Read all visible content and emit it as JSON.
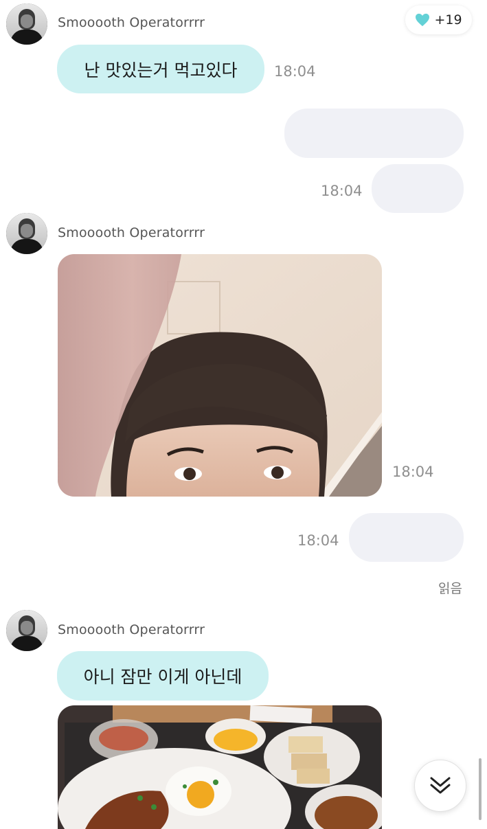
{
  "reaction": {
    "icon": "heart-icon",
    "count": "+19",
    "heart_color": "#63d1d6"
  },
  "messages": [
    {
      "sender": "Smooooth Operatorrrr",
      "text": "난 맛있는거 먹고있다",
      "time": "18:04"
    },
    {
      "outgoing_time": "18:04"
    },
    {
      "sender": "Smooooth Operatorrrr",
      "photo": "selfie-photo",
      "time": "18:04"
    },
    {
      "outgoing_time": "18:04",
      "status": "읽음"
    },
    {
      "sender": "Smooooth Operatorrrr",
      "text": "아니 잠만 이게 아닌데",
      "photo": "food-photo"
    }
  ],
  "scroll_button": {
    "icon": "double-chevron-down-icon"
  },
  "colors": {
    "incoming_bubble": "#cdf1f2",
    "outgoing_bubble": "#f0f1f6",
    "time_text": "#8f8f8f"
  }
}
